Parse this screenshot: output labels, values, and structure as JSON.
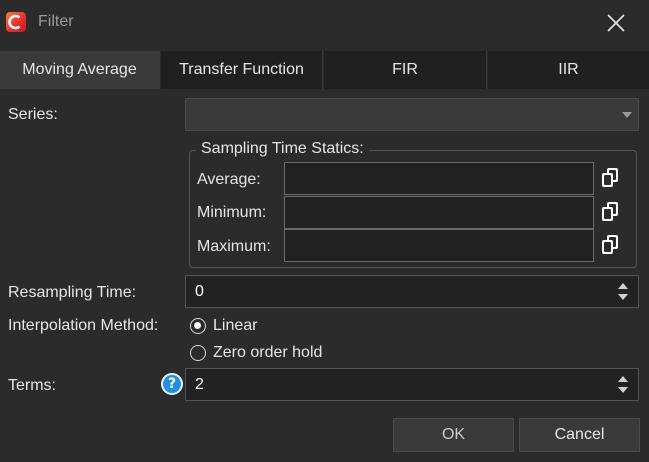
{
  "window": {
    "title": "Filter"
  },
  "tabs": [
    {
      "label": "Moving Average",
      "active": true
    },
    {
      "label": "Transfer Function",
      "active": false
    },
    {
      "label": "FIR",
      "active": false
    },
    {
      "label": "IIR",
      "active": false
    }
  ],
  "series": {
    "label": "Series:",
    "value": ""
  },
  "sampling": {
    "group_title": "Sampling Time Statics:",
    "average_label": "Average:",
    "average_value": "",
    "minimum_label": "Minimum:",
    "minimum_value": "",
    "maximum_label": "Maximum:",
    "maximum_value": ""
  },
  "resampling": {
    "label": "Resampling Time:",
    "value": "0"
  },
  "interpolation": {
    "label": "Interpolation Method:",
    "options": [
      {
        "label": "Linear",
        "checked": true
      },
      {
        "label": "Zero order hold",
        "checked": false
      }
    ]
  },
  "terms": {
    "label": "Terms:",
    "value": "2",
    "help_icon": "question-icon"
  },
  "buttons": {
    "ok": "OK",
    "cancel": "Cancel"
  },
  "colors": {
    "background": "#2b2b2b",
    "active_tab": "#3a3a3a",
    "help_blue": "#1e90e6",
    "logo_red": "#e8322c"
  }
}
